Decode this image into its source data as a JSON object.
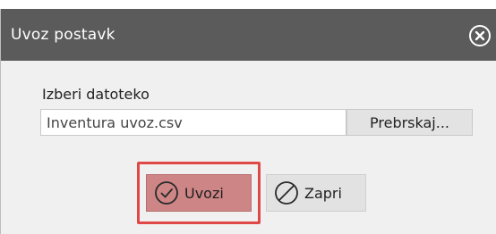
{
  "dialog": {
    "title": "Uvoz postavk",
    "close_icon": "close-circle-icon"
  },
  "file": {
    "label": "Izberi datoteko",
    "value": "Inventura uvoz.csv",
    "browse_label": "Prebrskaj..."
  },
  "actions": {
    "import_label": "Uvozi",
    "import_icon": "check-circle-icon",
    "close_label": "Zapri",
    "close_icon": "prohibited-circle-icon"
  },
  "colors": {
    "titlebar": "#5b5b5b",
    "import_button": "#cd8585",
    "highlight_border": "#e04848"
  }
}
